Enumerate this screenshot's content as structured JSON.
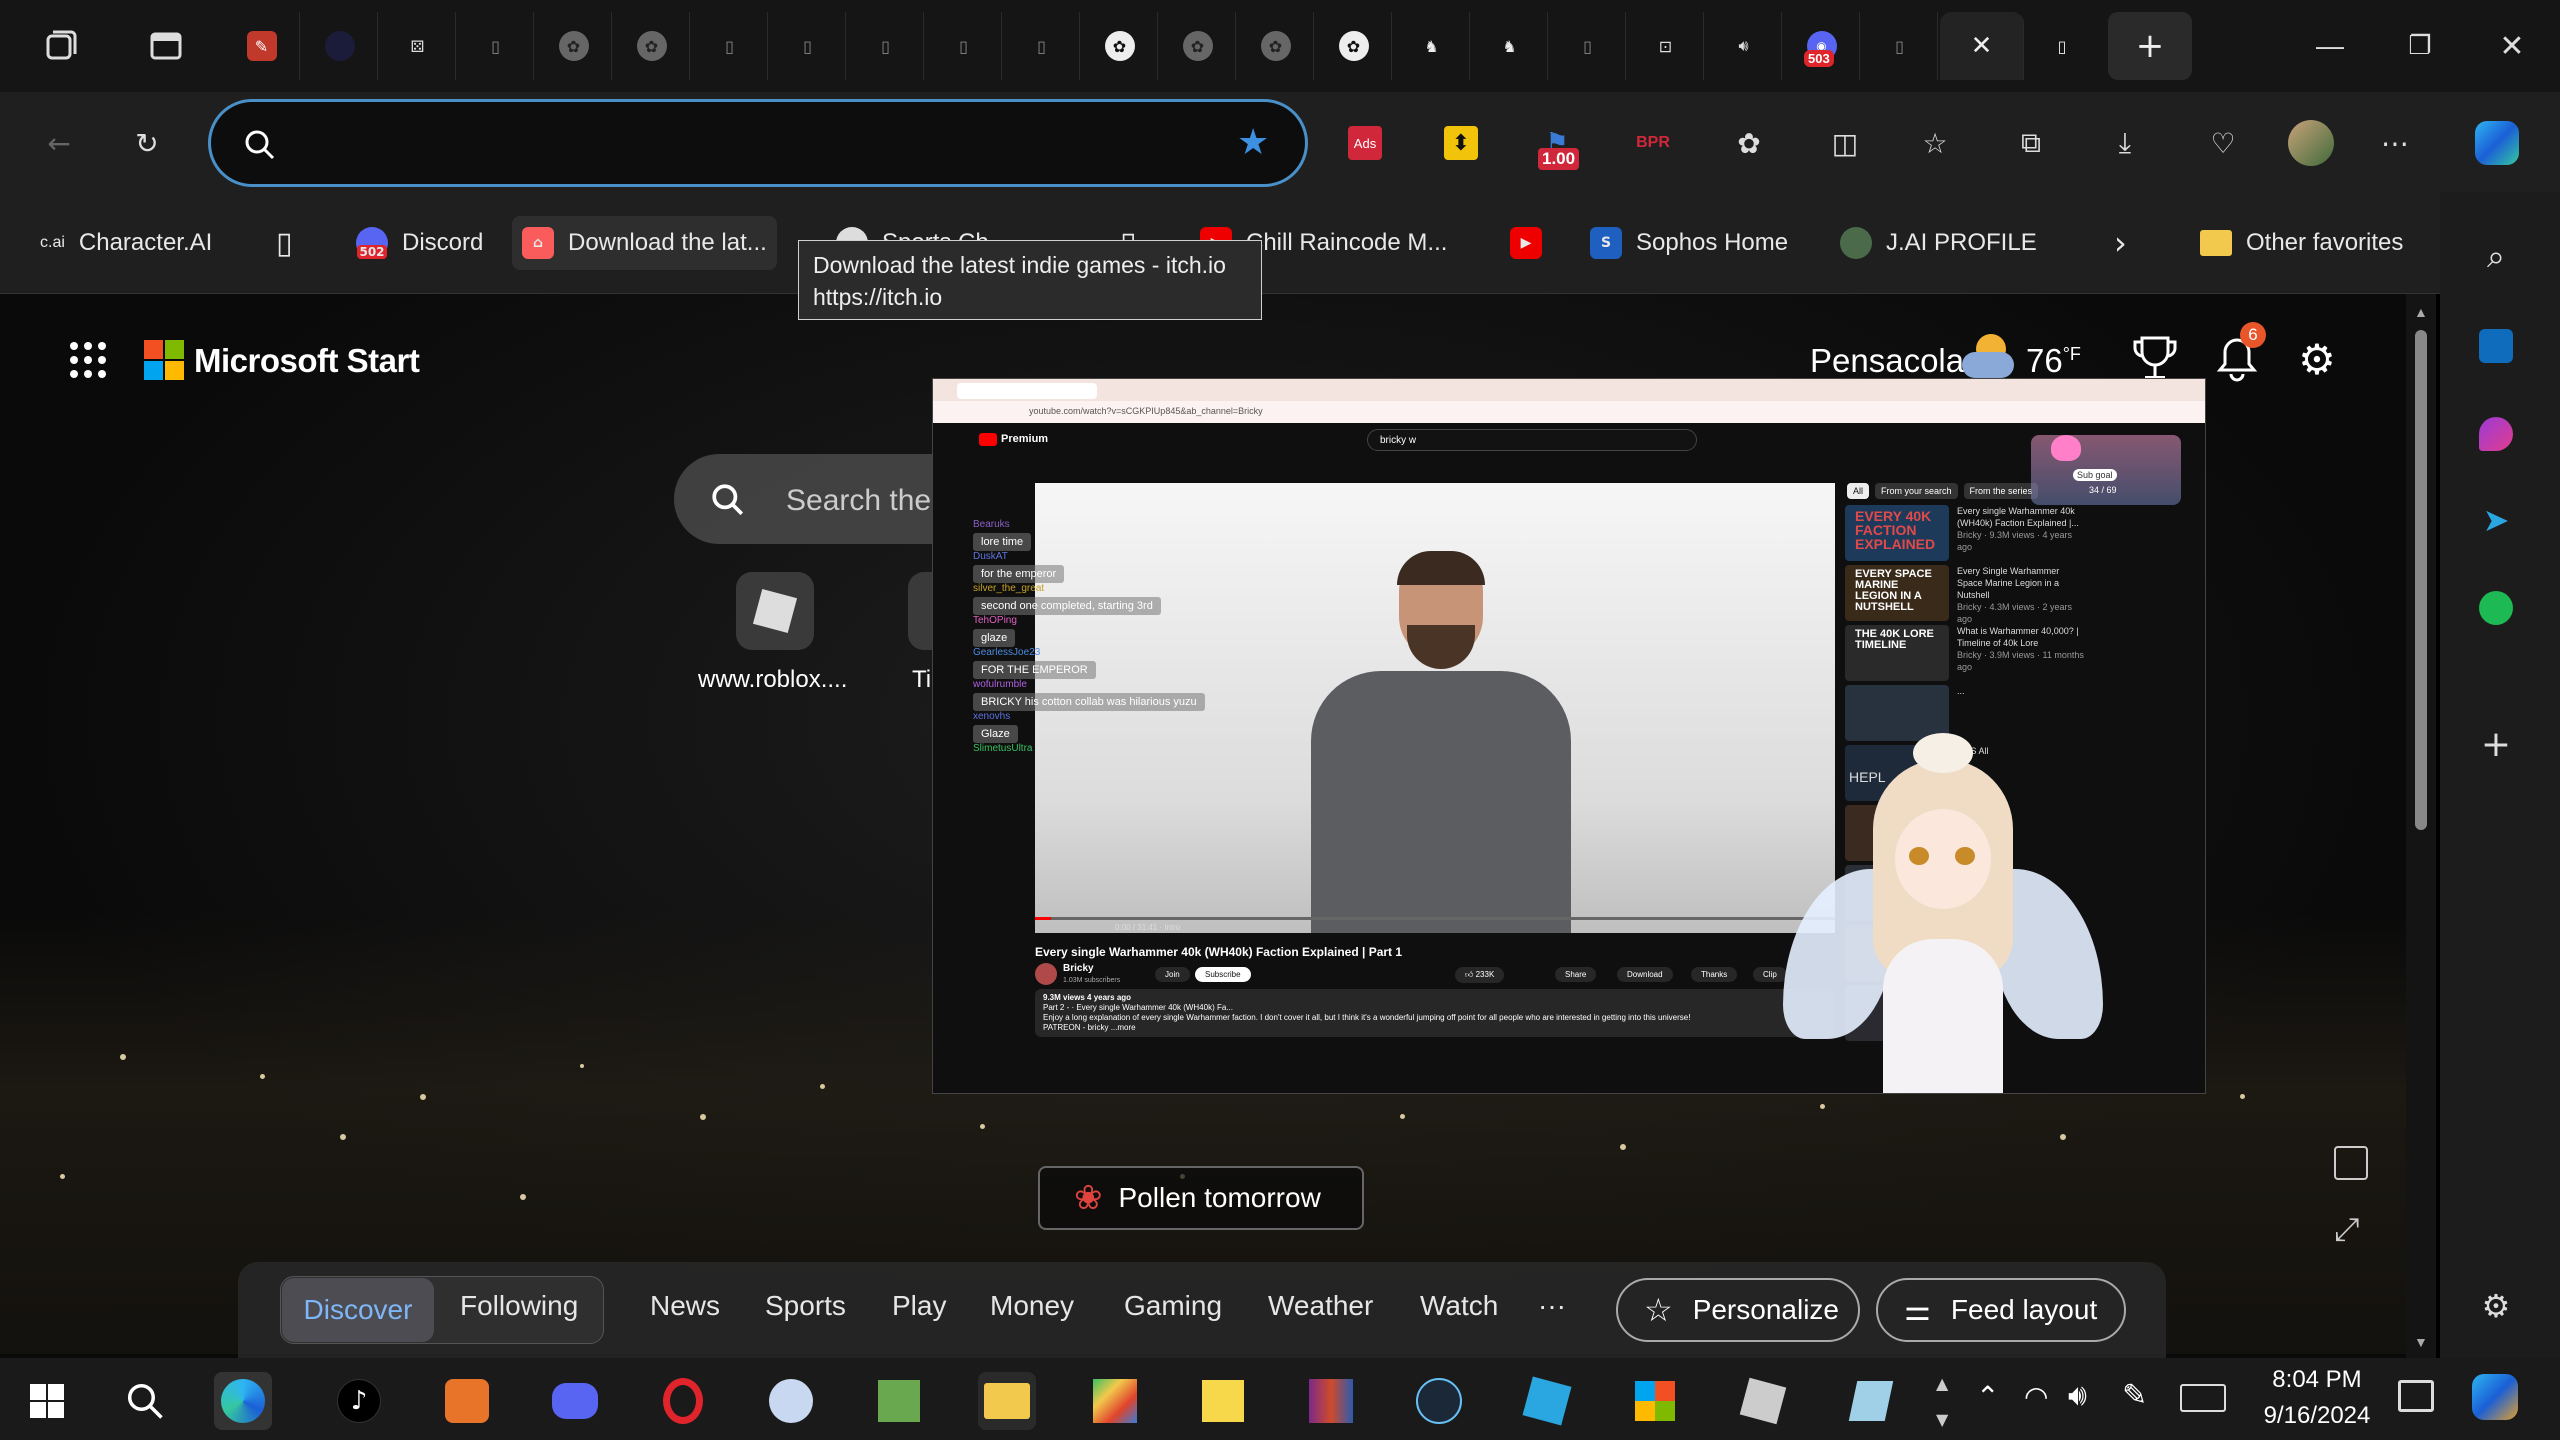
{
  "browser": {
    "tabs_count_icons": [
      "workspaces-icon",
      "tab-actions-icon",
      "edit-icon",
      "dark-circle-icon",
      "dice-icon",
      "page-icon",
      "openai-icon",
      "openai-icon",
      "page-icon",
      "page-icon",
      "page-icon",
      "page-icon",
      "page-icon",
      "openai-icon",
      "openai-icon",
      "openai-icon",
      "openai-icon",
      "game-icon",
      "game-icon",
      "page-icon",
      "controller-icon",
      "speaker-icon",
      "discord-icon",
      "page-icon"
    ],
    "discord_tab_badge": "503",
    "window_controls": {
      "minimize": "—",
      "restore": "❐",
      "close": "✕"
    },
    "address_value": "",
    "extension_badge": "1.00",
    "ext_ads_label": "Ads",
    "ext_bpr_label": "BPR",
    "favorites": [
      {
        "label": "Character.AI",
        "icon_text": "c.ai"
      },
      {
        "label": "",
        "icon_text": ""
      },
      {
        "label": "Discord",
        "icon_text": "502"
      },
      {
        "label": "Download the lat...",
        "icon_text": ""
      },
      {
        "label": "Sports Ch...",
        "icon_text": ""
      },
      {
        "label": "",
        "icon_text": ""
      },
      {
        "label": "Chill Raincode M...",
        "icon_text": ""
      },
      {
        "label": "",
        "icon_text": "▶"
      },
      {
        "label": "Sophos Home",
        "icon_text": "S"
      },
      {
        "label": "J.AI PROFILE",
        "icon_text": ""
      }
    ],
    "other_favorites": "Other favorites",
    "tooltip": {
      "title": "Download the latest indie games - itch.io",
      "url": "https://itch.io"
    }
  },
  "msn": {
    "brand": "Microsoft Start",
    "weather": {
      "city": "Pensacola",
      "temp": "76",
      "unit": "°F"
    },
    "notifications_badge": "6",
    "search_placeholder": "Search the",
    "tiles": [
      {
        "label": "www.roblox...."
      },
      {
        "label": "Ti"
      }
    ],
    "pollen": "Pollen tomorrow",
    "nav": {
      "discover": "Discover",
      "following": "Following",
      "items": [
        "News",
        "Sports",
        "Play",
        "Money",
        "Gaming",
        "Weather",
        "Watch"
      ],
      "more": "···",
      "personalize": "Personalize",
      "feed_layout": "Feed layout"
    }
  },
  "pip": {
    "yt_brand": "Premium",
    "url": "youtube.com/watch?v=sCGKPIUp845&ab_channel=Bricky",
    "search_query": "bricky w",
    "chips": [
      "All",
      "From your search",
      "From the series"
    ],
    "sub_goal": {
      "label": "Sub goal",
      "value": "34 / 69"
    },
    "chat": [
      {
        "user": "Bearuks",
        "msg": "lore time"
      },
      {
        "user": "DuskAT",
        "msg": "for the emperor"
      },
      {
        "user": "silver_the_great",
        "msg": "second one completed, starting 3rd"
      },
      {
        "user": "TehOPing",
        "msg": "glaze"
      },
      {
        "user": "GearlessJoe23",
        "msg": "FOR THE EMPEROR"
      },
      {
        "user": "wofulrumble",
        "msg": "BRICKY his cotton collab was hilarious yuzu"
      },
      {
        "user": "xenovhs",
        "msg": "Glaze"
      },
      {
        "user": "SlimetusUltra",
        "msg": ""
      }
    ],
    "video_time": "0:00 / 31:41 · Intro",
    "video_title": "Every single Warhammer 40k (WH40k) Faction Explained | Part 1",
    "channel": "Bricky",
    "subscribers": "1.03M subscribers",
    "join": "Join",
    "subscribe": "Subscribe",
    "likes": "233K",
    "actions": [
      "Share",
      "Download",
      "Thanks",
      "Clip"
    ],
    "desc_meta": "9.3M views 4 years ago",
    "desc_line1": "Part 2 - · Every single Warhammer 40k (WH40k) Fa...",
    "desc_line2": "Enjoy a long explanation of every single Warhammer faction. I don't cover it all, but I think it's a wonderful jumping off point for all people who are interested in getting into this universe!",
    "desc_line3": "PATREON - bricky ...more",
    "related": [
      {
        "title": "Every single Warhammer 40k (WH40k) Faction Explained |...",
        "meta": "Bricky · 9.3M views · 4 years ago",
        "thumb_text": "EVERY 40K FACTION EXPLAINED"
      },
      {
        "title": "Every Single Warhammer Space Marine Legion in a Nutshell",
        "meta": "Bricky · 4.3M views · 2 years ago",
        "thumb_text": "EVERY SPACE MARINE LEGION IN A NUTSHELL"
      },
      {
        "title": "What is Warhammer 40,000? | Timeline of 40k Lore",
        "meta": "Bricky · 3.9M views · 11 months ago",
        "thumb_text": "THE 40K LORE TIMELINE"
      },
      {
        "title": "...",
        "meta": "",
        "thumb_text": ""
      },
      {
        "title": "...ES All",
        "meta": "",
        "thumb_text": "HEPL"
      }
    ]
  },
  "taskbar": {
    "time": "8:04 PM",
    "date": "9/16/2024"
  }
}
